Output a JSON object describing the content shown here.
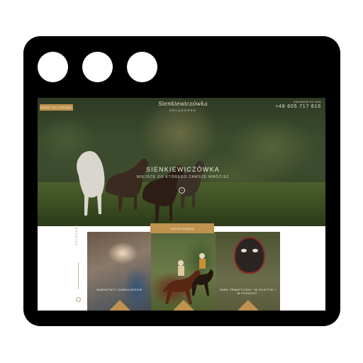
{
  "window": {
    "controls": [
      "window-dot-1",
      "window-dot-2",
      "window-dot-3"
    ]
  },
  "header": {
    "button_label": "WRÓĆ DO STRONY",
    "logo_script": "Sienkiewiczówka",
    "logo_sub": "OBLĘGOREK",
    "contact_label": "ZADZWOŃ DO NAS",
    "phone": "+48 605 717 816"
  },
  "hero": {
    "title": "SIENKIEWICZÓWKA",
    "subtitle": "MIEJSCE DO KTÓREGO ZAWSZE WRÓCISZ",
    "scroll_icon": "chevron-down-icon"
  },
  "section": {
    "tag": "JAZDA KONNA",
    "side_label": "POLECAMY"
  },
  "cards": [
    {
      "caption": "WARSZTATY GARNCARSKIE"
    },
    {
      "caption": ""
    },
    {
      "caption": "PARK TEMATYCZNY \"W PUSTYNI I W PUSZCZY\""
    }
  ],
  "colors": {
    "accent": "#c0924f",
    "frame": "#000000"
  }
}
